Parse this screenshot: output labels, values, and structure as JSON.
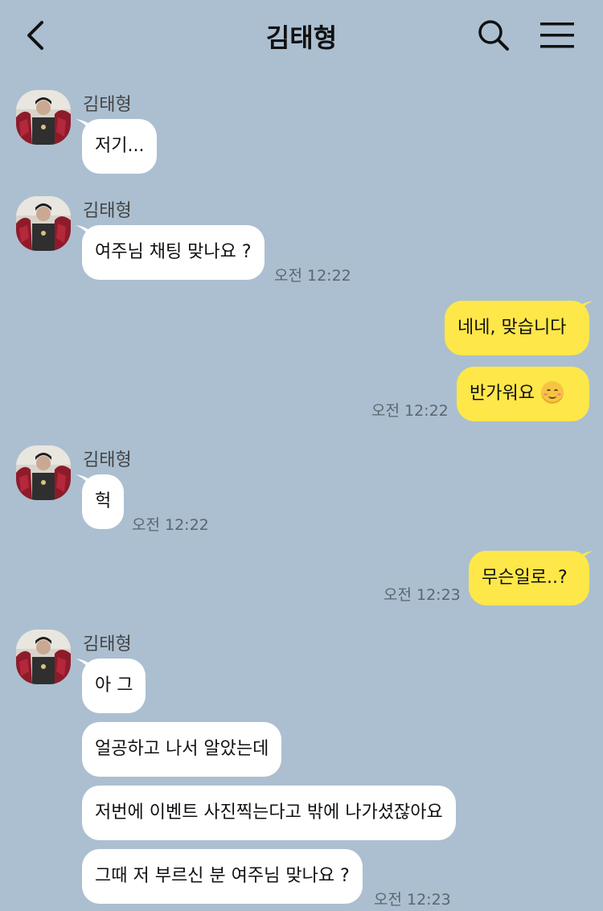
{
  "header": {
    "title": "김태형",
    "back_icon": "chevron-left-icon",
    "search_icon": "search-icon",
    "menu_icon": "hamburger-menu-icon"
  },
  "colors": {
    "background": "#abbfd0",
    "incoming_bubble": "#ffffff",
    "outgoing_bubble": "#fee749"
  },
  "messages": [
    {
      "direction": "in",
      "sender": "김태형",
      "text": "저기..."
    },
    {
      "direction": "in",
      "sender": "김태형",
      "text": "여주님 채팅 맞나요 ?",
      "time": "오전 12:22"
    },
    {
      "direction": "out",
      "text": "네네, 맞습니다"
    },
    {
      "direction": "out",
      "text": "반가워요",
      "emoji": "smiling-face-icon",
      "time": "오전 12:22"
    },
    {
      "direction": "in",
      "sender": "김태형",
      "text": "헉",
      "time": "오전 12:22"
    },
    {
      "direction": "out",
      "text": "무슨일로..?",
      "time": "오전 12:23"
    },
    {
      "direction": "in",
      "sender": "김태형",
      "text": "아 그"
    },
    {
      "direction": "in",
      "text": "얼공하고 나서 알았는데"
    },
    {
      "direction": "in",
      "text": "저번에 이벤트 사진찍는다고 밖에 나가셨잖아요"
    },
    {
      "direction": "in",
      "text": "그때 저 부르신 분 여주님 맞나요 ?",
      "time": "오전 12:23"
    }
  ]
}
